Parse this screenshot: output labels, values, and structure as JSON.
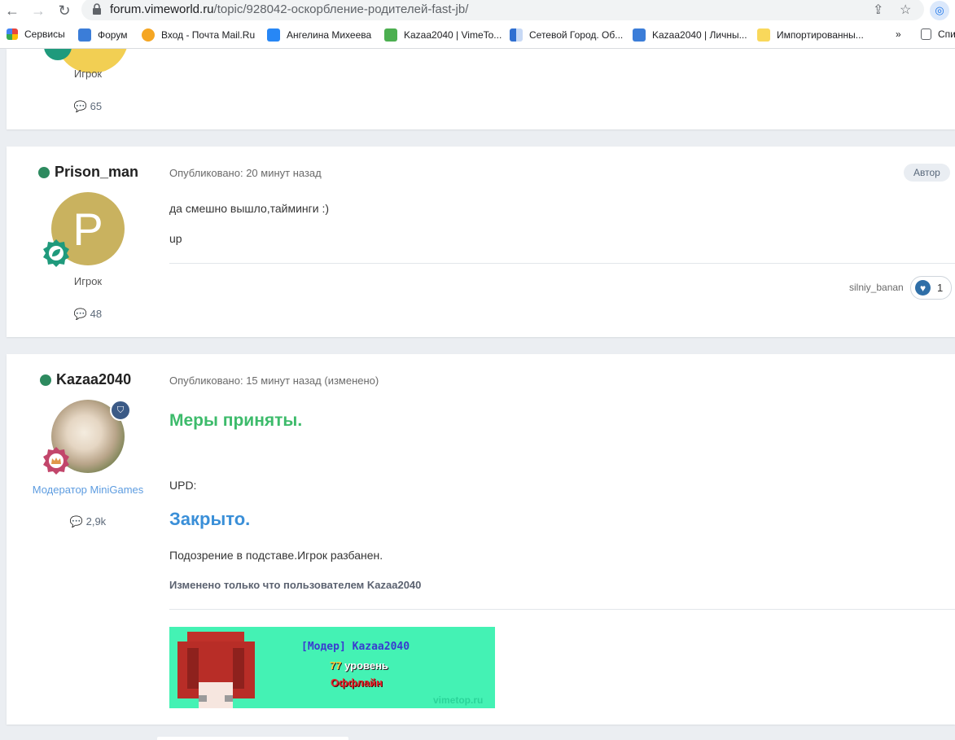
{
  "browser": {
    "url_host": "forum.vimeworld.ru",
    "url_path": "/topic/928042-оскорбление-родителей-fast-jb/",
    "bookmarks": [
      {
        "label": "Сервисы",
        "icon": "apps-grid-icon",
        "color": "#e8453c"
      },
      {
        "label": "Форум",
        "icon": "vime-icon",
        "color": "#3b7dd8"
      },
      {
        "label": "Вход - Почта Mail.Ru",
        "icon": "mail-at-icon",
        "color": "#f5a623"
      },
      {
        "label": "Ангелина Михеева",
        "icon": "vk-icon",
        "color": "#2787f5"
      },
      {
        "label": "Kazaa2040 | VimeTo...",
        "icon": "vimetop-icon",
        "color": "#4caf50"
      },
      {
        "label": "Сетевой Город. Об...",
        "icon": "grid-icon",
        "color": "#2f6fd1"
      },
      {
        "label": "Kazaa2040 | Личны...",
        "icon": "vime-icon",
        "color": "#3b7dd8"
      },
      {
        "label": "Импортированны...",
        "icon": "folder-icon",
        "color": "#f9d85b"
      },
      {
        "label": "»",
        "icon": "",
        "color": ""
      },
      {
        "label": "Спи",
        "icon": "reading-list-icon",
        "color": "#5f6368"
      }
    ]
  },
  "posts": [
    {
      "role": "Игрок",
      "count": "65"
    },
    {
      "username": "Prison_man",
      "avatar_letter": "P",
      "avatar_color": "#c9b25f",
      "role": "Игрок",
      "count": "48",
      "meta": "Опубликовано: 20 минут назад",
      "badge": "Автор",
      "lines": [
        "да смешно вышло,тайминги :)",
        "up"
      ],
      "reaction_user": "silniy_banan",
      "reaction_count": "1"
    },
    {
      "username": "Kazaa2040",
      "role": "Модератор MiniGames",
      "count": "2,9k",
      "meta": "Опубликовано: 15 минут назад (изменено)",
      "heading1": "Меры приняты.",
      "upd": "UPD:",
      "heading2": "Закрыто.",
      "body": "Подозрение в подставе.Игрок разбанен.",
      "edited": "Изменено только что пользователем Kazaa2040",
      "signature": {
        "name": "[Модер] Kazaa2040",
        "level_num": "77",
        "level_word": "уровень",
        "status": "Оффлайн",
        "site": "vimetop.ru"
      }
    }
  ],
  "colors": {
    "heading_green": "#3dbb6b",
    "heading_blue": "#3a8fd8",
    "moderator_blue": "#5d9ce0",
    "online_green": "#2d8a5f"
  }
}
